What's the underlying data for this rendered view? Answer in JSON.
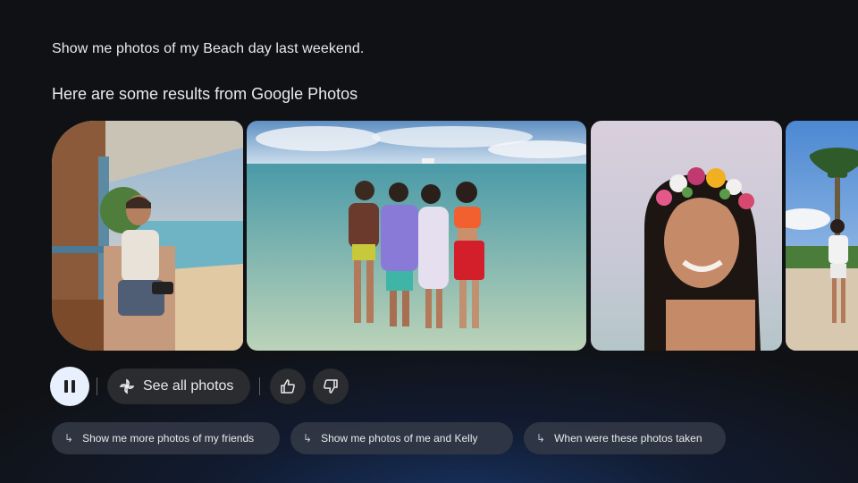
{
  "conversation": {
    "user_query": "Show me photos of my Beach day last weekend.",
    "assistant_response": "Here are some results from Google Photos"
  },
  "photos": [
    {
      "name": "photo-porch-woman",
      "icon": "photo"
    },
    {
      "name": "photo-beach-friends-group",
      "icon": "photo"
    },
    {
      "name": "photo-flower-crown-woman",
      "icon": "photo"
    },
    {
      "name": "photo-palm-tree-friends",
      "icon": "photo"
    }
  ],
  "controls": {
    "pause_icon": "pause-icon",
    "see_all_label": "See all photos",
    "see_all_icon": "pinwheel-icon",
    "thumbs_up_icon": "thumbs-up-icon",
    "thumbs_down_icon": "thumbs-down-icon"
  },
  "suggestions": [
    {
      "label": "Show me more photos of my friends",
      "icon": "reply-arrow-icon"
    },
    {
      "label": "Show me photos of me and Kelly",
      "icon": "reply-arrow-icon"
    },
    {
      "label": "When were these photos taken",
      "icon": "reply-arrow-icon"
    }
  ],
  "colors": {
    "background": "#101114",
    "glow": "#1e4ea0",
    "chip": "#343a46",
    "pause_button": "#e8f0fe"
  }
}
